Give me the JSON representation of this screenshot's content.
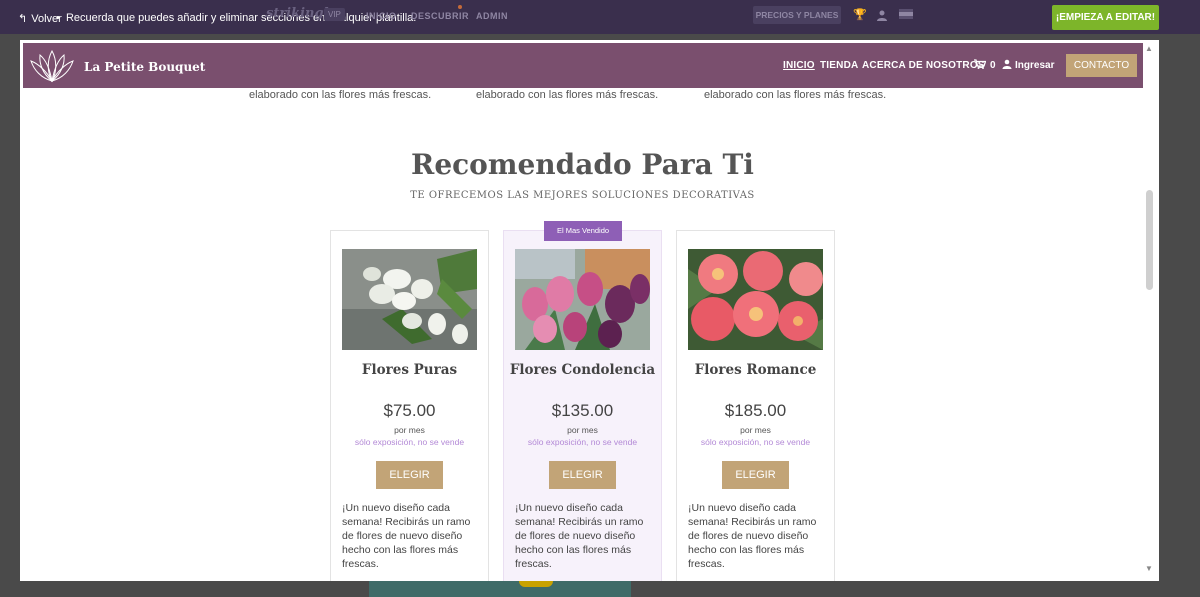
{
  "editor": {
    "back_label": "Volver",
    "hint": "Recuerda que puedes añadir y eliminar secciones en cualquier plantilla.",
    "logo": "strikingly",
    "vip": "VIP",
    "nav": [
      "INICIO",
      "DESCUBRIR",
      "ADMIN"
    ],
    "plans": "PRECIOS Y PLANES",
    "cta": "¡EMPIEZA A EDITAR!"
  },
  "site": {
    "brand": "La Petite Bouquet",
    "nav": {
      "home": "INICIO",
      "shop": "TIENDA",
      "about": "ACERCA DE NOSOTROS"
    },
    "cart_count": "0",
    "login": "Ingresar",
    "contact": "CONTACTO"
  },
  "previous_section": {
    "texts": [
      "elaborado con las flores más frescas.",
      "elaborado con las flores más frescas.",
      "elaborado con las flores más frescas."
    ]
  },
  "section": {
    "title": "Recomendado Para Ti",
    "subtitle": "TE OFRECEMOS LAS MEJORES SOLUCIONES DECORATIVAS",
    "featured_badge": "El Mas Vendido"
  },
  "cards": [
    {
      "title": "Flores Puras",
      "price": "$75.00",
      "per": "por mes",
      "note": "sólo exposición, no se vende",
      "button": "ELEGIR",
      "desc": "¡Un nuevo diseño cada semana! Recibirás un ramo de flores de nuevo diseño hecho con las flores más frescas."
    },
    {
      "title": "Flores Condolencia",
      "price": "$135.00",
      "per": "por mes",
      "note": "sólo exposición, no se vende",
      "button": "ELEGIR",
      "desc": "¡Un nuevo diseño cada semana! Recibirás un ramo de flores de nuevo diseño hecho con las flores más frescas."
    },
    {
      "title": "Flores Romance",
      "price": "$185.00",
      "per": "por mes",
      "note": "sólo exposición, no se vende",
      "button": "ELEGIR",
      "desc": "¡Un nuevo diseño cada semana! Recibirás un ramo de flores de nuevo diseño hecho con las flores más frescas."
    }
  ],
  "colors": {
    "editor_bar": "#3a2f4d",
    "cta_green": "#7db52a",
    "header_purple": "#7a4f6e",
    "gold": "#c2a477",
    "badge_purple": "#8e5fb6",
    "note_lilac": "#b389d6"
  },
  "icons": [
    "back-arrow-icon",
    "trophy-icon",
    "user-icon",
    "flag-icon",
    "lotus-logo-icon",
    "cart-icon",
    "person-icon",
    "scroll-up-icon",
    "scroll-down-icon"
  ]
}
